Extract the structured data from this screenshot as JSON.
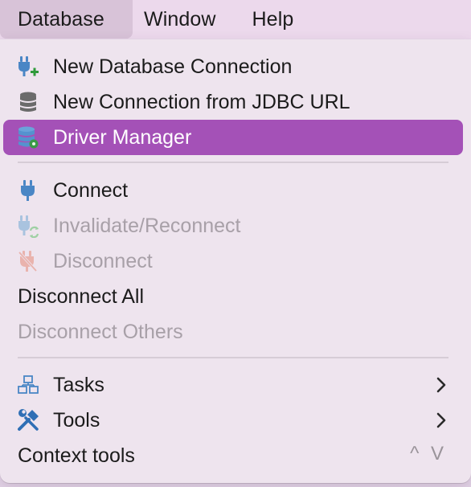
{
  "menubar": {
    "items": [
      {
        "label": "Database",
        "active": true
      },
      {
        "label": "Window"
      },
      {
        "label": "Help"
      }
    ]
  },
  "menu": {
    "highlight_color": "#a451b7",
    "items": [
      {
        "label": "New Database Connection",
        "icon": "plug-plus-icon",
        "enabled": true
      },
      {
        "label": "New Connection from JDBC URL",
        "icon": "database-stack-icon",
        "enabled": true
      },
      {
        "label": "Driver Manager",
        "icon": "database-driver-icon",
        "enabled": true,
        "highlighted": true
      },
      {
        "label": "Connect",
        "icon": "plug-icon",
        "enabled": true
      },
      {
        "label": "Invalidate/Reconnect",
        "icon": "plug-refresh-icon",
        "enabled": false
      },
      {
        "label": "Disconnect",
        "icon": "plug-disconnect-icon",
        "enabled": false
      },
      {
        "label": "Disconnect All",
        "icon": null,
        "enabled": true
      },
      {
        "label": "Disconnect Others",
        "icon": null,
        "enabled": false
      },
      {
        "label": "Tasks",
        "icon": "tasks-icon",
        "enabled": true,
        "submenu": true
      },
      {
        "label": "Tools",
        "icon": "tools-icon",
        "enabled": true,
        "submenu": true
      },
      {
        "label": "Context tools",
        "icon": null,
        "enabled": true,
        "shortcut": "^ V"
      }
    ]
  }
}
